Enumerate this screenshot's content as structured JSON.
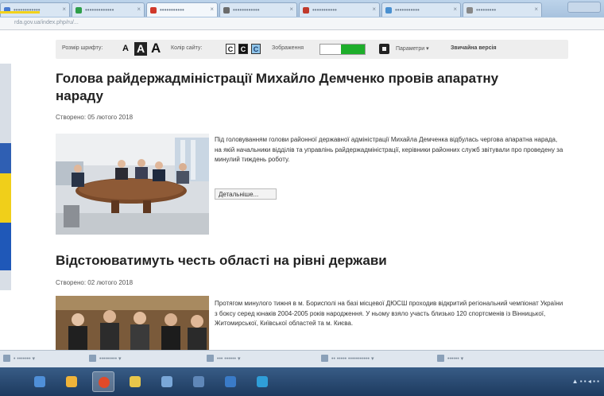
{
  "browser": {
    "tabs": [
      {
        "label": "••••••••••••",
        "fav_color": "#4a7bd0"
      },
      {
        "label": "•••••••••••••",
        "fav_color": "#2e9e4a"
      },
      {
        "label": "•••••••••••",
        "fav_color": "#d0392b",
        "active": true
      },
      {
        "label": "••••••••••••",
        "fav_color": "#6b6b6b"
      },
      {
        "label": "•••••••••••",
        "fav_color": "#c0392b"
      },
      {
        "label": "•••••••••••",
        "fav_color": "#4a90d0"
      },
      {
        "label": "•••••••••",
        "fav_color": "#888888"
      }
    ],
    "url": "rda.gov.ua/index.php/ru/..."
  },
  "a11y": {
    "font_size_label": "Розмір шрифту:",
    "font_a_small": "A",
    "font_a_boxed": "A",
    "font_a_large": "A",
    "site_color_label": "Колір сайту:",
    "color_buttons": [
      "C",
      "C",
      "C"
    ],
    "images_label": "Зображення",
    "settings_label": "Параметри",
    "standard_version": "Звичайна версія"
  },
  "articles": [
    {
      "title_line1": "Голова райдержадміністрації Михайло Демченко провів апаратну",
      "title_line2": "нараду",
      "created": "Створено: 05 лютого 2018",
      "excerpt": "Під головуванням голови районної державної адміністрації Михайла Демченка відбулась чергова апаратна нарада, на якій начальники відділів та управлінь райдержадміністрації, керівники районних служб звітували про проведену за минулий тиждень роботу.",
      "more": "Детальніше..."
    },
    {
      "title_line1": "Відстоюватимуть честь області на рівні держави",
      "created": "Створено: 02 лютого 2018",
      "excerpt": "Протягом минулого тижня в м. Борисполі на базі місцевої ДЮСШ проходив відкритий регіональний чемпіонат України з боксу серед юнаків 2004-2005 років народження. У ньому взяло участь близько 120 спортсменів із Вінницької, Житомирської, Київської областей та м. Києва."
    }
  ],
  "downloads": [
    "• •••••••",
    "•••••••••",
    "••• ••••••",
    "•• ••••• •••••••••••",
    "••••••"
  ],
  "colors": {
    "toggle_on": "#1eae2b",
    "taskbar": "#1d3a5f",
    "accent_yellow": "#f2d21b"
  }
}
